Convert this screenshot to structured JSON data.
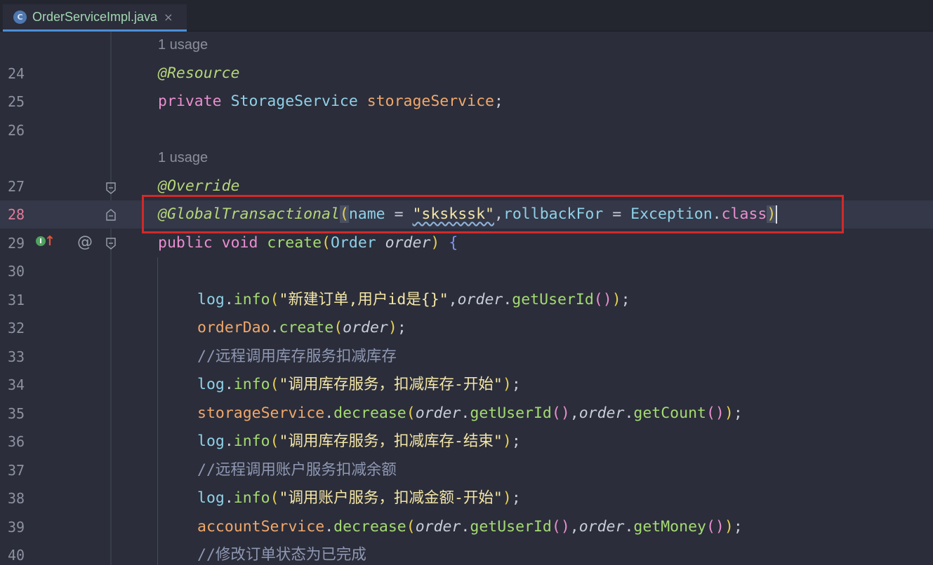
{
  "tab": {
    "icon": "C",
    "title": "OrderServiceImpl.java",
    "close": "×"
  },
  "inlay_hint": "1 usage",
  "gutter": {
    "at_symbol": "@",
    "impl_icon_letter": "I",
    "impl_arrow": "↑"
  },
  "lines": {
    "l24": {
      "num": "24",
      "text": "@Resource"
    },
    "l25": {
      "num": "25",
      "kw": "private",
      "type": "StorageService",
      "field": "storageService",
      "end": ";"
    },
    "l26": {
      "num": "26"
    },
    "l27": {
      "num": "27",
      "text": "@Override"
    },
    "l28": {
      "num": "28",
      "anno": "@GlobalTransactional",
      "attr1": "name",
      "eq": " = ",
      "str": "\"skskssk\"",
      "comma": ",",
      "attr2": "rollbackFor",
      "type": "Exception",
      "dot": ".",
      "kw": "class"
    },
    "l29": {
      "num": "29",
      "kw1": "public",
      "kw2": "void",
      "fn": "create",
      "type": "Order",
      "param": "order"
    },
    "l30": {
      "num": "30"
    },
    "l31": {
      "num": "31",
      "obj": "log",
      "fn": "info",
      "str": "\"新建订单,用户id是{}\"",
      "param": "order",
      "call": "getUserId"
    },
    "l32": {
      "num": "32",
      "obj": "orderDao",
      "fn": "create",
      "param": "order"
    },
    "l33": {
      "num": "33",
      "comment": "//远程调用库存服务扣减库存"
    },
    "l34": {
      "num": "34",
      "obj": "log",
      "fn": "info",
      "str": "\"调用库存服务，扣减库存-开始\""
    },
    "l35": {
      "num": "35",
      "obj": "storageService",
      "fn": "decrease",
      "param": "order",
      "call1": "getUserId",
      "call2": "getCount"
    },
    "l36": {
      "num": "36",
      "obj": "log",
      "fn": "info",
      "str": "\"调用库存服务，扣减库存-结束\""
    },
    "l37": {
      "num": "37",
      "comment": "//远程调用账户服务扣减余额"
    },
    "l38": {
      "num": "38",
      "obj": "log",
      "fn": "info",
      "str": "\"调用账户服务，扣减金额-开始\""
    },
    "l39": {
      "num": "39",
      "obj": "accountService",
      "fn": "decrease",
      "param": "order",
      "call1": "getUserId",
      "call2": "getMoney"
    },
    "l40": {
      "num": "40",
      "comment": "//修改订单状态为已完成"
    }
  },
  "colors": {
    "highlight_box": "#d12a2a",
    "background": "#2b2d3a",
    "current_line": "#343848"
  }
}
